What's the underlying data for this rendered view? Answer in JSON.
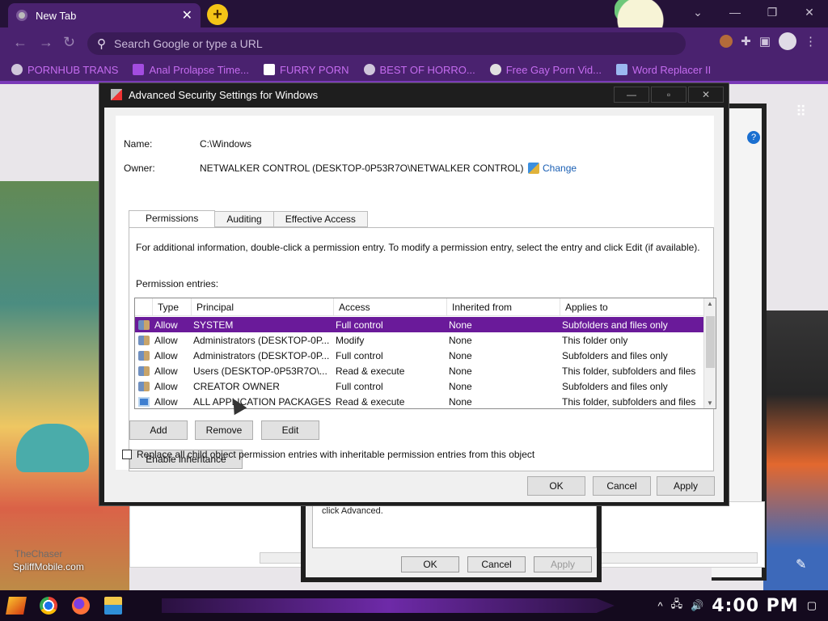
{
  "browser": {
    "tab_title": "New Tab",
    "omnibox_placeholder": "Search Google or type a URL",
    "bookmarks": [
      "PORNHUB TRANS",
      "Anal Prolapse Time...",
      "FURRY PORN",
      "BEST OF HORRO...",
      "Free Gay Porn Vid...",
      "Word Replacer II"
    ]
  },
  "dialog": {
    "title": "Advanced Security Settings for Windows",
    "name_label": "Name:",
    "name_value": "C:\\Windows",
    "owner_label": "Owner:",
    "owner_value": "NETWALKER CONTROL (DESKTOP-0P53R7O\\NETWALKER CONTROL)",
    "change_label": "Change",
    "tabs": [
      "Permissions",
      "Auditing",
      "Effective Access"
    ],
    "info_text": "For additional information, double-click a permission entry. To modify a permission entry, select the entry and click Edit (if available).",
    "entries_label": "Permission entries:",
    "columns": [
      "Type",
      "Principal",
      "Access",
      "Inherited from",
      "Applies to"
    ],
    "rows": [
      {
        "type": "Allow",
        "principal": "SYSTEM",
        "access": "Full control",
        "inherited": "None",
        "applies": "Subfolders and files only"
      },
      {
        "type": "Allow",
        "principal": "Administrators (DESKTOP-0P...",
        "access": "Modify",
        "inherited": "None",
        "applies": "This folder only"
      },
      {
        "type": "Allow",
        "principal": "Administrators (DESKTOP-0P...",
        "access": "Full control",
        "inherited": "None",
        "applies": "Subfolders and files only"
      },
      {
        "type": "Allow",
        "principal": "Users (DESKTOP-0P53R7O\\...",
        "access": "Read & execute",
        "inherited": "None",
        "applies": "This folder, subfolders and files"
      },
      {
        "type": "Allow",
        "principal": "CREATOR OWNER",
        "access": "Full control",
        "inherited": "None",
        "applies": "Subfolders and files only"
      },
      {
        "type": "Allow",
        "principal": "ALL APPLICATION PACKAGES",
        "access": "Read & execute",
        "inherited": "None",
        "applies": "This folder, subfolders and files"
      }
    ],
    "add_label": "Add",
    "remove_label": "Remove",
    "edit_label": "Edit",
    "enable_inheritance_label": "Enable inheritance",
    "replace_label": "Replace all child object permission entries with inheritable permission entries from this object",
    "ok_label": "OK",
    "cancel_label": "Cancel",
    "apply_label": "Apply"
  },
  "background_dialog": {
    "text": "click Advanced.",
    "ok_label": "OK",
    "cancel_label": "Cancel",
    "apply_label": "Apply"
  },
  "wallpaper": {
    "watermark1": "TheChaser",
    "watermark2": "SpliffMobile.com"
  },
  "taskbar": {
    "clock": "4:00 PM"
  }
}
